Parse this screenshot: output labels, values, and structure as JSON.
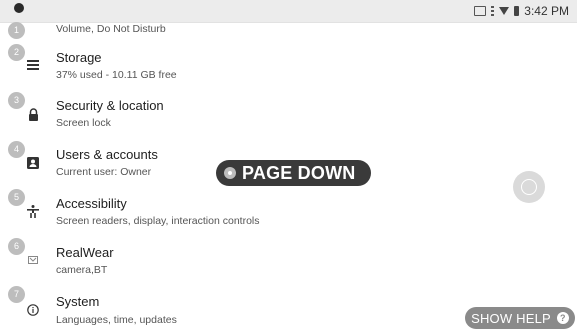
{
  "status_bar": {
    "time": "3:42 PM"
  },
  "settings": [
    {
      "badge": "1",
      "icon": "volume-icon",
      "title": "",
      "subtitle": "Volume, Do Not Disturb"
    },
    {
      "badge": "2",
      "icon": "storage-icon",
      "title": "Storage",
      "subtitle": "37% used - 10.11 GB free"
    },
    {
      "badge": "3",
      "icon": "lock-icon",
      "title": "Security & location",
      "subtitle": "Screen lock"
    },
    {
      "badge": "4",
      "icon": "account-icon",
      "title": "Users & accounts",
      "subtitle": "Current user: Owner"
    },
    {
      "badge": "5",
      "icon": "accessibility-icon",
      "title": "Accessibility",
      "subtitle": "Screen readers, display, interaction controls"
    },
    {
      "badge": "6",
      "icon": "realwear-icon",
      "title": "RealWear",
      "subtitle": "camera,BT"
    },
    {
      "badge": "7",
      "icon": "info-icon",
      "title": "System",
      "subtitle": "Languages, time, updates"
    }
  ],
  "overlay": {
    "page_down_label": "PAGE DOWN",
    "show_help_label": "SHOW HELP",
    "help_glyph": "?"
  }
}
